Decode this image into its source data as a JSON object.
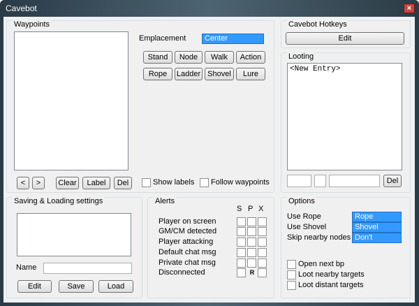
{
  "window": {
    "title": "Cavebot",
    "close_glyph": "×"
  },
  "waypoints": {
    "title": "Waypoints",
    "emplacement_label": "Emplacement",
    "emplacement_value": "Center",
    "type_buttons_row1": [
      "Stand",
      "Node",
      "Walk",
      "Action"
    ],
    "type_buttons_row2": [
      "Rope",
      "Ladder",
      "Shovel",
      "Lure"
    ],
    "prev_glyph": "<",
    "next_glyph": ">",
    "clear_label": "Clear",
    "label_label": "Label",
    "del_label": "Del",
    "show_labels": "Show labels",
    "follow_waypoints": "Follow waypoints"
  },
  "hotkeys": {
    "title": "Cavebot Hotkeys",
    "edit_label": "Edit"
  },
  "looting": {
    "title": "Looting",
    "entries": [
      "<New Entry>"
    ],
    "del_label": "Del"
  },
  "saving": {
    "title": "Saving & Loading settings",
    "name_label": "Name",
    "edit_label": "Edit",
    "save_label": "Save",
    "load_label": "Load"
  },
  "alerts": {
    "title": "Alerts",
    "columns": [
      "S",
      "P",
      "X"
    ],
    "rows": [
      {
        "label": "Player on screen"
      },
      {
        "label": "GM/CM detected"
      },
      {
        "label": "Player attacking"
      },
      {
        "label": "Default chat msg"
      },
      {
        "label": "Private chat msg"
      },
      {
        "label": "Disconnected",
        "p_mark": "R"
      }
    ]
  },
  "options": {
    "title": "Options",
    "use_rope_label": "Use Rope",
    "use_rope_value": "Rope",
    "use_shovel_label": "Use Shovel",
    "use_shovel_value": "Shovel",
    "skip_nodes_label": "Skip nearby nodes",
    "skip_nodes_value": "Don't",
    "open_next_bp": "Open next bp",
    "loot_nearby": "Loot nearby targets",
    "loot_distant": "Loot distant targets"
  },
  "colors": {
    "selection": "#3399ff",
    "titlebar": "#3a4e5b",
    "close": "#c4483d"
  }
}
